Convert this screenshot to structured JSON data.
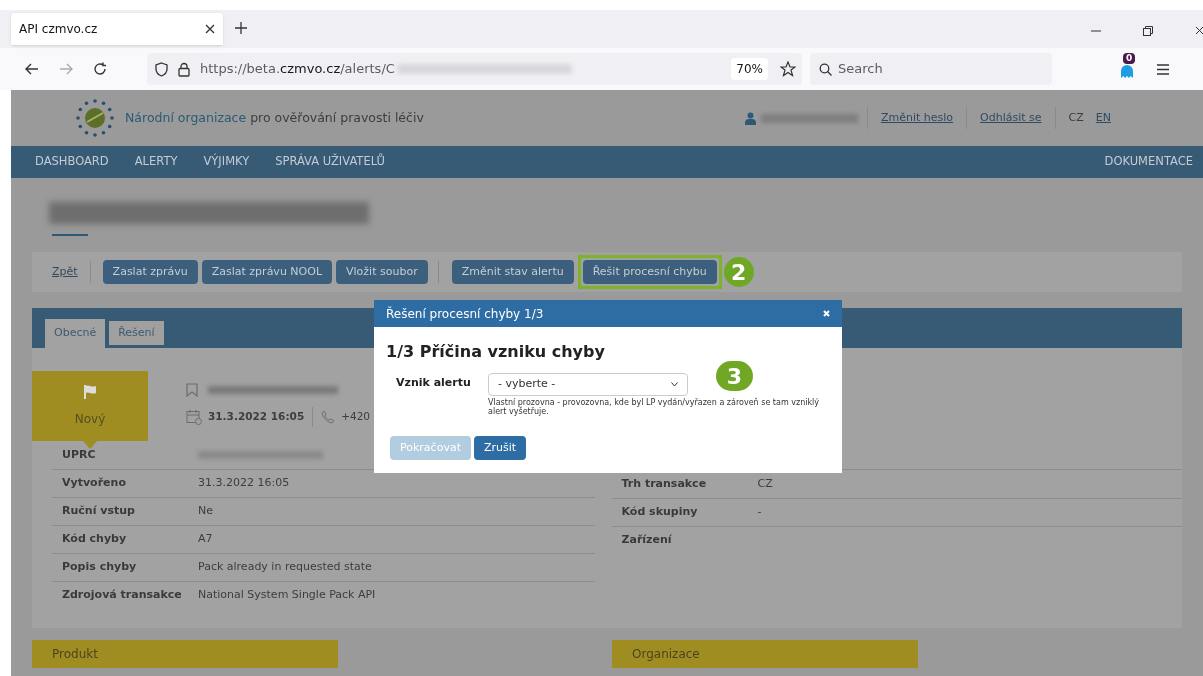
{
  "browser": {
    "tab_title": "API czmvo.cz",
    "url_prefix": "https://beta.",
    "url_domain": "czmvo.cz",
    "url_path": "/alerts/C",
    "zoom": "70%",
    "search_placeholder": "Search",
    "extension_badge": "0"
  },
  "header": {
    "org_highlight": "Národní organizace",
    "org_rest": "pro ověřování pravosti léčiv",
    "links": [
      "Změnit heslo",
      "Odhlásit se"
    ],
    "languages": [
      {
        "label": "CZ",
        "selected": true
      },
      {
        "label": "EN",
        "selected": false
      }
    ]
  },
  "nav": {
    "items": [
      "DASHBOARD",
      "ALERTY",
      "VÝJIMKY",
      "SPRÁVA UŽIVATELŮ"
    ],
    "right": "DOKUMENTACE"
  },
  "toolbar": {
    "back": "Zpět",
    "button_groups": [
      [
        {
          "label": "Zaslat zprávu",
          "highlighted": false
        },
        {
          "label": "Zaslat zprávu NOOL",
          "highlighted": false
        },
        {
          "label": "Vložit soubor",
          "highlighted": false
        }
      ],
      [
        {
          "label": "Změnit stav alertu",
          "highlighted": false
        },
        {
          "label": "Řešit procesní chybu",
          "highlighted": true
        }
      ]
    ],
    "step_badge": "2"
  },
  "tabs": [
    {
      "label": "Obecné",
      "selected": true
    },
    {
      "label": "Řešení",
      "selected": false
    }
  ],
  "status": {
    "label": "Nový",
    "date": "31.3.2022 16:05",
    "phone": "+420"
  },
  "details_left": [
    {
      "label": "UPRC",
      "value_blurred": true
    },
    {
      "label": "Vytvořeno",
      "value": "31.3.2022 16:05"
    },
    {
      "label": "Ruční vstup",
      "value": "Ne"
    },
    {
      "label": "Kód chyby",
      "value": "A7"
    },
    {
      "label": "Popis chyby",
      "value": "Pack already in requested state"
    },
    {
      "label": "Zdrojová transakce",
      "value": "National System Single Pack API"
    }
  ],
  "details_right": [
    {
      "label": "Trh transakce",
      "value": "CZ"
    },
    {
      "label": "Kód skupiny",
      "value": "-"
    },
    {
      "label": "Zařízení"
    }
  ],
  "sections": [
    "Produkt",
    "Organizace"
  ],
  "modal": {
    "title": "Řešení procesní chyby 1/3",
    "heading": "1/3 Příčina vzniku chyby",
    "field_label": "Vznik alertu",
    "select_value": "- vyberte -",
    "hint": "Vlastní prozovna - provozovna, kde byl LP vydán/vyřazen a zároveň se tam vzniklý alert vyšetřuje.",
    "step_badge": "3",
    "buttons": [
      {
        "label": "Pokračovat",
        "disabled": true
      },
      {
        "label": "Zrušit",
        "disabled": false
      }
    ]
  }
}
